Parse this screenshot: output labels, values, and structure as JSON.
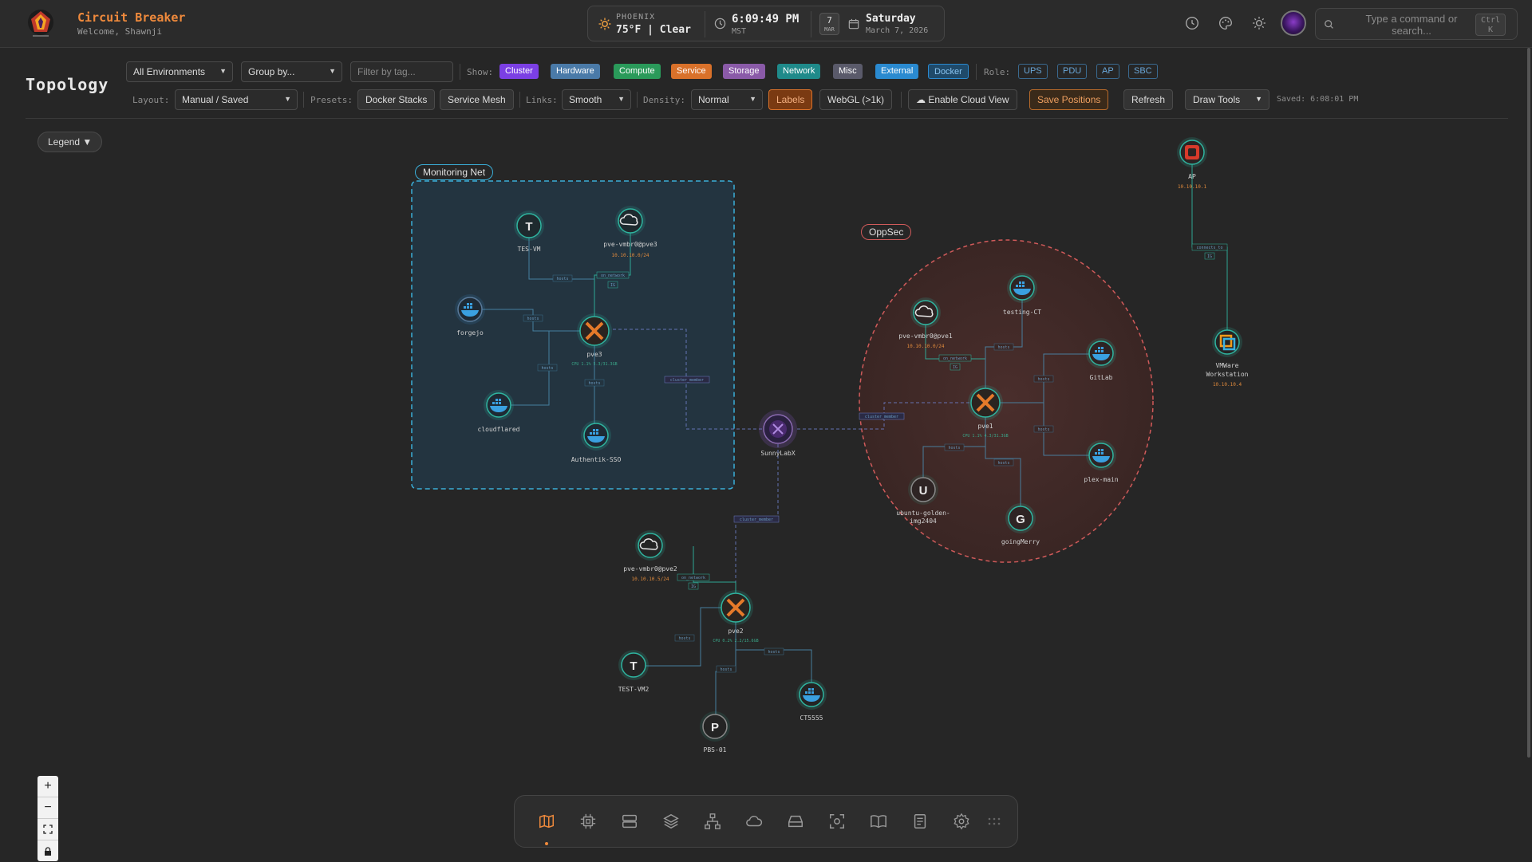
{
  "header": {
    "app_title": "Circuit Breaker",
    "welcome": "Welcome, Shawnji",
    "weather": {
      "city": "PHOENIX",
      "temp": "75°F | Clear"
    },
    "clock": {
      "time": "6:09:49 PM",
      "tz": "MST"
    },
    "date": {
      "day": "7",
      "month": "MAR",
      "weekday": "Saturday",
      "full": "March 7, 2026"
    },
    "search": {
      "placeholder": "Type a command or search...",
      "shortcut": "Ctrl K"
    }
  },
  "toolbar": {
    "page_title": "Topology",
    "environment": "All Environments",
    "group_by": "Group by...",
    "tag_filter_placeholder": "Filter by tag...",
    "show_label": "Show:",
    "show_chips": [
      {
        "label": "Cluster",
        "color": "#7b3fe4"
      },
      {
        "label": "Hardware",
        "color": "#4a7aa8"
      },
      {
        "label": "Compute",
        "color": "#2a9a5a"
      },
      {
        "label": "Service",
        "color": "#d9712a"
      },
      {
        "label": "Storage",
        "color": "#8a5aa8"
      },
      {
        "label": "Network",
        "color": "#1f8a8a"
      },
      {
        "label": "Misc",
        "color": "#5a5a6a"
      },
      {
        "label": "External",
        "color": "#2a8ad0"
      },
      {
        "label": "Docker",
        "color": "#1f4a6a"
      }
    ],
    "role_label": "Role:",
    "roles": [
      "UPS",
      "PDU",
      "AP",
      "SBC"
    ],
    "layout_label": "Layout:",
    "layout_value": "Manual / Saved",
    "presets_label": "Presets:",
    "presets": [
      "Docker Stacks",
      "Service Mesh"
    ],
    "links_label": "Links:",
    "links_value": "Smooth",
    "density_label": "Density:",
    "density_value": "Normal",
    "labels_btn": "Labels",
    "webgl_btn": "WebGL (>1k)",
    "cloud_btn": "☁ Enable Cloud View",
    "save_btn": "Save Positions",
    "refresh_btn": "Refresh",
    "draw_tools_btn": "Draw Tools",
    "saved_text": "Saved: 6:08:01 PM"
  },
  "legend_btn": "Legend ▼",
  "groups": {
    "monitoring": "Monitoring Net",
    "oppsec": "OppSec"
  },
  "nodes": {
    "tes_vm": {
      "name": "TES-VM",
      "glyph": "T"
    },
    "pve_vmbr0_pve3": {
      "name": "pve-vmbr0@pve3",
      "sub": "10.10.10.0/24"
    },
    "forgejo": {
      "name": "forgejo"
    },
    "pve3": {
      "name": "pve3",
      "sub": "CPU 1.1% 5.3/31.3GB"
    },
    "cloudflared": {
      "name": "cloudflared"
    },
    "authentik": {
      "name": "Authentik-SSO"
    },
    "sunnylabx": {
      "name": "SunnyLabX"
    },
    "pve_vmbr0_pve1": {
      "name": "pve-vmbr0@pve1",
      "sub": "10.10.10.0/24"
    },
    "testing_ct": {
      "name": "testing-CT"
    },
    "gitlab": {
      "name": "GitLab"
    },
    "pve1": {
      "name": "pve1",
      "sub": "CPU 1.1% 4.3/31.3GB"
    },
    "plex": {
      "name": "plex-main"
    },
    "ubuntu": {
      "name": "ubuntu-golden-",
      "name2": "img2404",
      "glyph": "U"
    },
    "goingmerry": {
      "name": "goingMerry",
      "glyph": "G"
    },
    "pve_vmbr0_pve2": {
      "name": "pve-vmbr0@pve2",
      "sub": "10.10.10.5/24"
    },
    "pve2": {
      "name": "pve2",
      "sub": "CPU 0.2% 2.2/15.6GB"
    },
    "test_vm2": {
      "name": "TEST-VM2",
      "glyph": "T"
    },
    "ct5555": {
      "name": "CT5555"
    },
    "pbs01": {
      "name": "PBS-01",
      "glyph": "P"
    },
    "ap": {
      "name": "AP",
      "sub": "10.10.10.1"
    },
    "vmware": {
      "name": "VMWare",
      "name2": "Workstation",
      "sub": "10.10.10.4"
    }
  },
  "edge_tags": {
    "hosts": "hosts",
    "on_network": "on_network",
    "cluster_member": "cluster_member",
    "ip": "IG",
    "connects_to": "connects_to"
  },
  "colors": {
    "accent": "#f08a3c",
    "node_ring": "#2fb5a0",
    "edge": "#4a8ab0",
    "monitoring_group": "#2a9ad0",
    "oppsec_group": "#d05a5a"
  },
  "dock": [
    "map-icon",
    "cpu-icon",
    "server-icon",
    "layers-icon",
    "network-icon",
    "cloud-icon",
    "storage-icon",
    "scan-icon",
    "book-icon",
    "log-icon",
    "settings-icon",
    "grid-icon"
  ]
}
